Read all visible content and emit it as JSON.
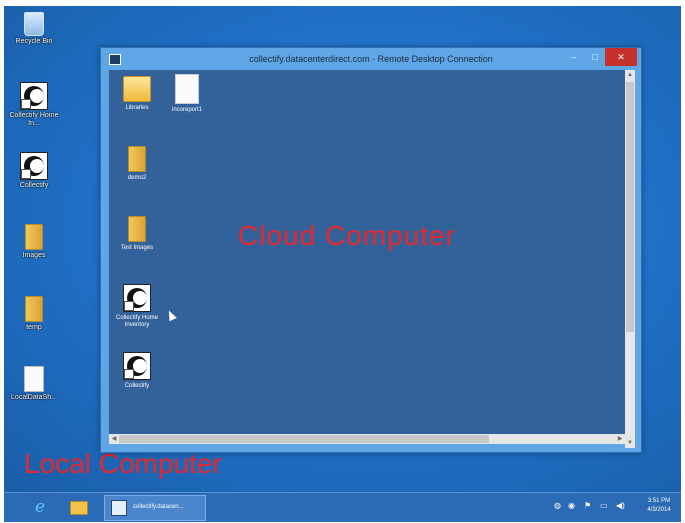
{
  "desktop": {
    "icons": [
      {
        "label": "Recycle Bin",
        "icon": "recycle-bin-icon"
      },
      {
        "label": "Collectify Home In...",
        "icon": "collectify-shortcut-icon"
      },
      {
        "label": "Collectify",
        "icon": "collectify-shortcut-icon"
      },
      {
        "label": "Images",
        "icon": "folder-icon"
      },
      {
        "label": "temp",
        "icon": "folder-icon"
      },
      {
        "label": "LocalDataSh...",
        "icon": "document-icon"
      }
    ]
  },
  "rdp_window": {
    "title": "collectify.datacenterdirect.com - Remote Desktop Connection",
    "buttons": {
      "minimize": "–",
      "maximize": "□",
      "close": "✕"
    },
    "remote_icons": [
      {
        "label": "Libraries",
        "icon": "libraries-icon"
      },
      {
        "label": "incoreport1",
        "icon": "report-icon"
      },
      {
        "label": "demo2",
        "icon": "user-folder-icon"
      },
      {
        "label": "Test Images",
        "icon": "folder-icon"
      },
      {
        "label": "Collectify Home Inventory",
        "icon": "collectify-shortcut-icon"
      },
      {
        "label": "Collectify",
        "icon": "collectify-shortcut-icon"
      }
    ],
    "annotation": "Cloud Computer"
  },
  "local_annotation": "Local Computer",
  "taskbar": {
    "pinned": [
      {
        "name": "internet-explorer",
        "glyph": "e"
      },
      {
        "name": "file-explorer"
      }
    ],
    "active_task": "collectify.datacen...",
    "tray": {
      "icons": [
        "network-icon",
        "flag-icon",
        "speaker-icon"
      ]
    },
    "clock": {
      "time": "3:51 PM",
      "date": "4/3/2014"
    }
  },
  "colors": {
    "annotation_red": "#e8262b",
    "desktop_blue": "#1f6fc5",
    "remote_blue": "#33629a",
    "close_red": "#c7312b"
  }
}
